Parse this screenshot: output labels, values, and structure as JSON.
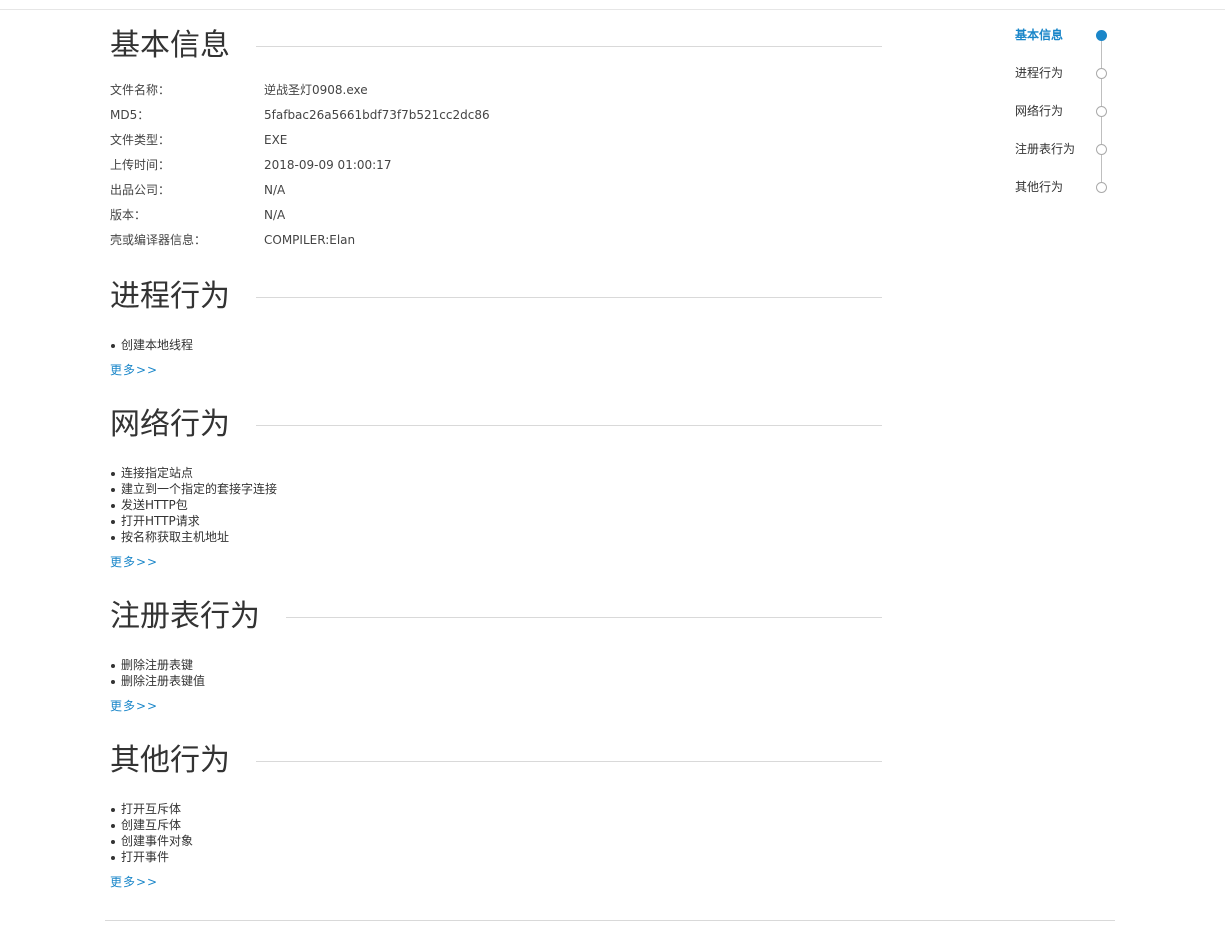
{
  "sections": {
    "basic": {
      "title": "基本信息",
      "rows": [
        {
          "label": "文件名称：",
          "value": "逆战圣灯0908.exe"
        },
        {
          "label": "MD5：",
          "value": "5fafbac26a5661bdf73f7b521cc2dc86"
        },
        {
          "label": "文件类型：",
          "value": "EXE"
        },
        {
          "label": "上传时间：",
          "value": "2018-09-09 01:00:17"
        },
        {
          "label": "出品公司：",
          "value": "N/A"
        },
        {
          "label": "版本：",
          "value": "N/A"
        },
        {
          "label": "壳或编译器信息：",
          "value": "COMPILER:Elan"
        }
      ]
    },
    "process": {
      "title": "进程行为",
      "items": [
        "创建本地线程"
      ],
      "more": "更多>>"
    },
    "network": {
      "title": "网络行为",
      "items": [
        "连接指定站点",
        "建立到一个指定的套接字连接",
        "发送HTTP包",
        "打开HTTP请求",
        "按名称获取主机地址"
      ],
      "more": "更多>>"
    },
    "registry": {
      "title": "注册表行为",
      "items": [
        "删除注册表键",
        "删除注册表键值"
      ],
      "more": "更多>>"
    },
    "other": {
      "title": "其他行为",
      "items": [
        "打开互斥体",
        "创建互斥体",
        "创建事件对象",
        "打开事件"
      ],
      "more": "更多>>"
    }
  },
  "side_nav": {
    "items": [
      {
        "label": "基本信息",
        "active": true
      },
      {
        "label": "进程行为",
        "active": false
      },
      {
        "label": "网络行为",
        "active": false
      },
      {
        "label": "注册表行为",
        "active": false
      },
      {
        "label": "其他行为",
        "active": false
      }
    ]
  },
  "colors": {
    "accent": "#1a86c9",
    "text": "#333333",
    "rule": "#d9d9d9"
  }
}
